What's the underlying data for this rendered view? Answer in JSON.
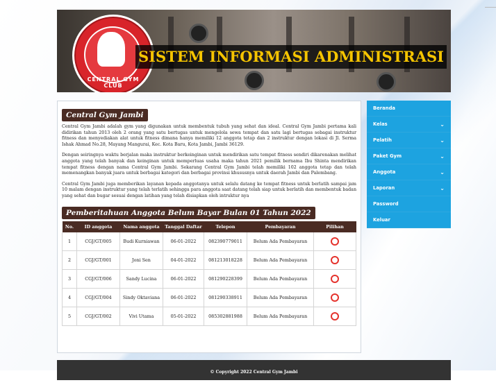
{
  "header": {
    "logo_text": "CENTRAL GYM CLUB",
    "title": "SISTEM INFORMASI ADMINISTRASI"
  },
  "about": {
    "title": "Central Gym Jambi",
    "paragraphs": [
      "Central Gym Jambi adalah gym yang digunakan untuk membentuk tubuh yang sehat dan ideal. Central Gym Jambi pertama kali didirikan tahun 2013 oleh 2 orang yang satu bertugas untuk mengelola sewa tempat dan satu lagi bertugas sebagai instruktur fitness dan menyediakan alat untuk fitness dimana hanya memiliki 12 anggota tetap dan 2 instruktur dengan lokasi di Jl. Serma Ishak Ahmad No.28, Mayang Mangurai, Kec. Kota Baru, Kota Jambi, Jambi 36129.",
      "Dengan seiringnya waktu berjalan maka instruktur berkeinginan untuk mendirikan satu tempat fitness sendiri dikarenakan melihat anggota yang telah banyak dan keinginan untuk memperluas usaha maka tahun 2021 pemilik bernama Ibu Shinta mendirikan tempat fitness dengan nama Central Gym Jambi. Sekarang Central Gym Jambi telah memiliki 102 anggota tetap dan telah memenangkan banyak juara untuk berbagai kategori dan berbagai provinsi khususnya untuk daerah Jambi dan Palembang.",
      "Central Gym Jambi juga memberikan layanan kepada anggotanya untuk selalu datang ke tempat fitness untuk berlatih sampai jam 10 malam dengan instruktur yang telah terlatih sehingga para anggota saat datang telah siap untuk berlatih dan membentuk badan yang sehat dan bugar sesuai dengan latihan yang telah disiapkan oleh intruktur nya"
    ]
  },
  "notice": {
    "title": "Pemberitahuan Anggota Belum Bayar Bulan 01 Tahun 2022",
    "columns": [
      "No.",
      "ID anggota",
      "Nama anggota",
      "Tanggal Daftar",
      "Telepon",
      "Pembayaran",
      "Pilihan"
    ],
    "rows": [
      {
        "no": "1",
        "id": "CGJ/GT/005",
        "nama": "Budi Kurniawan",
        "tanggal": "06-01-2022",
        "telepon": "082390779011",
        "pembayaran": "Belum Ada Pembayaran"
      },
      {
        "no": "2",
        "id": "CGJ/GT/001",
        "nama": "Joni Sen",
        "tanggal": "04-01-2022",
        "telepon": "081213018228",
        "pembayaran": "Belum Ada Pembayaran"
      },
      {
        "no": "3",
        "id": "CGJ/GT/006",
        "nama": "Sandy Lucina",
        "tanggal": "06-01-2022",
        "telepon": "081290228399",
        "pembayaran": "Belum Ada Pembayaran"
      },
      {
        "no": "4",
        "id": "CGJ/GT/004",
        "nama": "Sindy Oktaviana",
        "tanggal": "06-01-2022",
        "telepon": "081290338911",
        "pembayaran": "Belum Ada Pembayaran"
      },
      {
        "no": "5",
        "id": "CGJ/GT/002",
        "nama": "Vivi Utama",
        "tanggal": "05-01-2022",
        "telepon": "085302881988",
        "pembayaran": "Belum Ada Pembayaran"
      }
    ]
  },
  "sidebar": {
    "items": [
      {
        "label": "Beranda",
        "chevron": false
      },
      {
        "label": "Kelas",
        "chevron": true
      },
      {
        "label": "Pelatih",
        "chevron": true
      },
      {
        "label": "Paket Gym",
        "chevron": true
      },
      {
        "label": "Anggota",
        "chevron": true
      },
      {
        "label": "Laporan",
        "chevron": true
      },
      {
        "label": "Password",
        "chevron": false
      },
      {
        "label": "Keluar",
        "chevron": false
      }
    ]
  },
  "footer": {
    "text": "© Copyright 2022 Central Gym Jambi"
  },
  "colors": {
    "accent": "#1da3e0",
    "header_brown": "#4a2b23",
    "title_yellow": "#f5c400",
    "status_red": "#e5322c"
  }
}
